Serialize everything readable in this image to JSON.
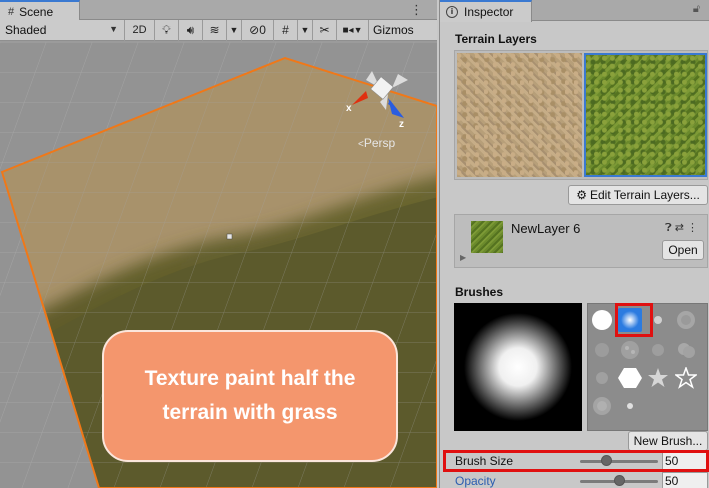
{
  "scene": {
    "tab_label": "Scene",
    "tab_icon": "grid-icon",
    "shading_mode": "Shaded",
    "toggle_2d": "2D",
    "hidden_objects_count": "0",
    "gizmos_label": "Gizmos",
    "persp_label": "Persp",
    "axis_labels": {
      "x": "x",
      "z": "z"
    },
    "callout_text": "Texture paint half the terrain with grass"
  },
  "inspector": {
    "tab_label": "Inspector",
    "terrain_layers_title": "Terrain Layers",
    "edit_terrain_layers_button": "Edit Terrain Layers...",
    "selected_layer_name": "NewLayer 6",
    "open_button": "Open",
    "brushes_title": "Brushes",
    "new_brush_button": "New Brush...",
    "properties": [
      {
        "label": "Brush Size",
        "value": "50",
        "fraction": 0.33
      },
      {
        "label": "Opacity",
        "value": "50",
        "fraction": 0.5
      }
    ]
  },
  "colors": {
    "highlight_red": "#e01010",
    "callout_fill": "#f4966d",
    "selection_orange": "#f07818",
    "accent_blue": "#3a79d1",
    "opacity_label_blue": "#2a5db0"
  }
}
